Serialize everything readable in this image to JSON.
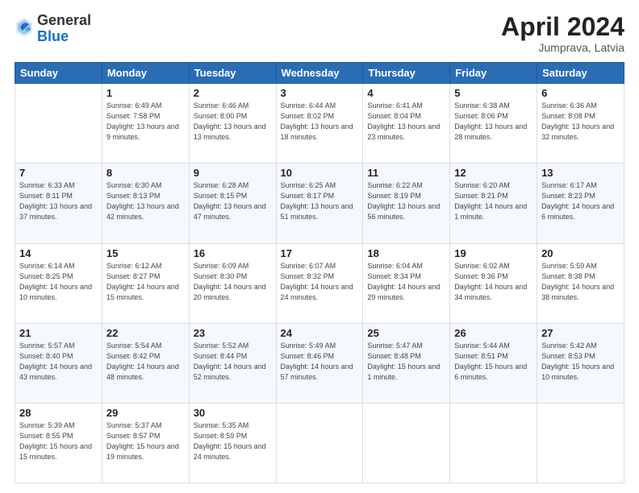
{
  "logo": {
    "general": "General",
    "blue": "Blue"
  },
  "header": {
    "month": "April 2024",
    "location": "Jumprava, Latvia"
  },
  "days_of_week": [
    "Sunday",
    "Monday",
    "Tuesday",
    "Wednesday",
    "Thursday",
    "Friday",
    "Saturday"
  ],
  "weeks": [
    [
      {
        "num": "",
        "sunrise": "",
        "sunset": "",
        "daylight": ""
      },
      {
        "num": "1",
        "sunrise": "Sunrise: 6:49 AM",
        "sunset": "Sunset: 7:58 PM",
        "daylight": "Daylight: 13 hours and 9 minutes."
      },
      {
        "num": "2",
        "sunrise": "Sunrise: 6:46 AM",
        "sunset": "Sunset: 8:00 PM",
        "daylight": "Daylight: 13 hours and 13 minutes."
      },
      {
        "num": "3",
        "sunrise": "Sunrise: 6:44 AM",
        "sunset": "Sunset: 8:02 PM",
        "daylight": "Daylight: 13 hours and 18 minutes."
      },
      {
        "num": "4",
        "sunrise": "Sunrise: 6:41 AM",
        "sunset": "Sunset: 8:04 PM",
        "daylight": "Daylight: 13 hours and 23 minutes."
      },
      {
        "num": "5",
        "sunrise": "Sunrise: 6:38 AM",
        "sunset": "Sunset: 8:06 PM",
        "daylight": "Daylight: 13 hours and 28 minutes."
      },
      {
        "num": "6",
        "sunrise": "Sunrise: 6:36 AM",
        "sunset": "Sunset: 8:08 PM",
        "daylight": "Daylight: 13 hours and 32 minutes."
      }
    ],
    [
      {
        "num": "7",
        "sunrise": "Sunrise: 6:33 AM",
        "sunset": "Sunset: 8:11 PM",
        "daylight": "Daylight: 13 hours and 37 minutes."
      },
      {
        "num": "8",
        "sunrise": "Sunrise: 6:30 AM",
        "sunset": "Sunset: 8:13 PM",
        "daylight": "Daylight: 13 hours and 42 minutes."
      },
      {
        "num": "9",
        "sunrise": "Sunrise: 6:28 AM",
        "sunset": "Sunset: 8:15 PM",
        "daylight": "Daylight: 13 hours and 47 minutes."
      },
      {
        "num": "10",
        "sunrise": "Sunrise: 6:25 AM",
        "sunset": "Sunset: 8:17 PM",
        "daylight": "Daylight: 13 hours and 51 minutes."
      },
      {
        "num": "11",
        "sunrise": "Sunrise: 6:22 AM",
        "sunset": "Sunset: 8:19 PM",
        "daylight": "Daylight: 13 hours and 56 minutes."
      },
      {
        "num": "12",
        "sunrise": "Sunrise: 6:20 AM",
        "sunset": "Sunset: 8:21 PM",
        "daylight": "Daylight: 14 hours and 1 minute."
      },
      {
        "num": "13",
        "sunrise": "Sunrise: 6:17 AM",
        "sunset": "Sunset: 8:23 PM",
        "daylight": "Daylight: 14 hours and 6 minutes."
      }
    ],
    [
      {
        "num": "14",
        "sunrise": "Sunrise: 6:14 AM",
        "sunset": "Sunset: 8:25 PM",
        "daylight": "Daylight: 14 hours and 10 minutes."
      },
      {
        "num": "15",
        "sunrise": "Sunrise: 6:12 AM",
        "sunset": "Sunset: 8:27 PM",
        "daylight": "Daylight: 14 hours and 15 minutes."
      },
      {
        "num": "16",
        "sunrise": "Sunrise: 6:09 AM",
        "sunset": "Sunset: 8:30 PM",
        "daylight": "Daylight: 14 hours and 20 minutes."
      },
      {
        "num": "17",
        "sunrise": "Sunrise: 6:07 AM",
        "sunset": "Sunset: 8:32 PM",
        "daylight": "Daylight: 14 hours and 24 minutes."
      },
      {
        "num": "18",
        "sunrise": "Sunrise: 6:04 AM",
        "sunset": "Sunset: 8:34 PM",
        "daylight": "Daylight: 14 hours and 29 minutes."
      },
      {
        "num": "19",
        "sunrise": "Sunrise: 6:02 AM",
        "sunset": "Sunset: 8:36 PM",
        "daylight": "Daylight: 14 hours and 34 minutes."
      },
      {
        "num": "20",
        "sunrise": "Sunrise: 5:59 AM",
        "sunset": "Sunset: 8:38 PM",
        "daylight": "Daylight: 14 hours and 38 minutes."
      }
    ],
    [
      {
        "num": "21",
        "sunrise": "Sunrise: 5:57 AM",
        "sunset": "Sunset: 8:40 PM",
        "daylight": "Daylight: 14 hours and 43 minutes."
      },
      {
        "num": "22",
        "sunrise": "Sunrise: 5:54 AM",
        "sunset": "Sunset: 8:42 PM",
        "daylight": "Daylight: 14 hours and 48 minutes."
      },
      {
        "num": "23",
        "sunrise": "Sunrise: 5:52 AM",
        "sunset": "Sunset: 8:44 PM",
        "daylight": "Daylight: 14 hours and 52 minutes."
      },
      {
        "num": "24",
        "sunrise": "Sunrise: 5:49 AM",
        "sunset": "Sunset: 8:46 PM",
        "daylight": "Daylight: 14 hours and 57 minutes."
      },
      {
        "num": "25",
        "sunrise": "Sunrise: 5:47 AM",
        "sunset": "Sunset: 8:48 PM",
        "daylight": "Daylight: 15 hours and 1 minute."
      },
      {
        "num": "26",
        "sunrise": "Sunrise: 5:44 AM",
        "sunset": "Sunset: 8:51 PM",
        "daylight": "Daylight: 15 hours and 6 minutes."
      },
      {
        "num": "27",
        "sunrise": "Sunrise: 5:42 AM",
        "sunset": "Sunset: 8:53 PM",
        "daylight": "Daylight: 15 hours and 10 minutes."
      }
    ],
    [
      {
        "num": "28",
        "sunrise": "Sunrise: 5:39 AM",
        "sunset": "Sunset: 8:55 PM",
        "daylight": "Daylight: 15 hours and 15 minutes."
      },
      {
        "num": "29",
        "sunrise": "Sunrise: 5:37 AM",
        "sunset": "Sunset: 8:57 PM",
        "daylight": "Daylight: 15 hours and 19 minutes."
      },
      {
        "num": "30",
        "sunrise": "Sunrise: 5:35 AM",
        "sunset": "Sunset: 8:59 PM",
        "daylight": "Daylight: 15 hours and 24 minutes."
      },
      {
        "num": "",
        "sunrise": "",
        "sunset": "",
        "daylight": ""
      },
      {
        "num": "",
        "sunrise": "",
        "sunset": "",
        "daylight": ""
      },
      {
        "num": "",
        "sunrise": "",
        "sunset": "",
        "daylight": ""
      },
      {
        "num": "",
        "sunrise": "",
        "sunset": "",
        "daylight": ""
      }
    ]
  ]
}
